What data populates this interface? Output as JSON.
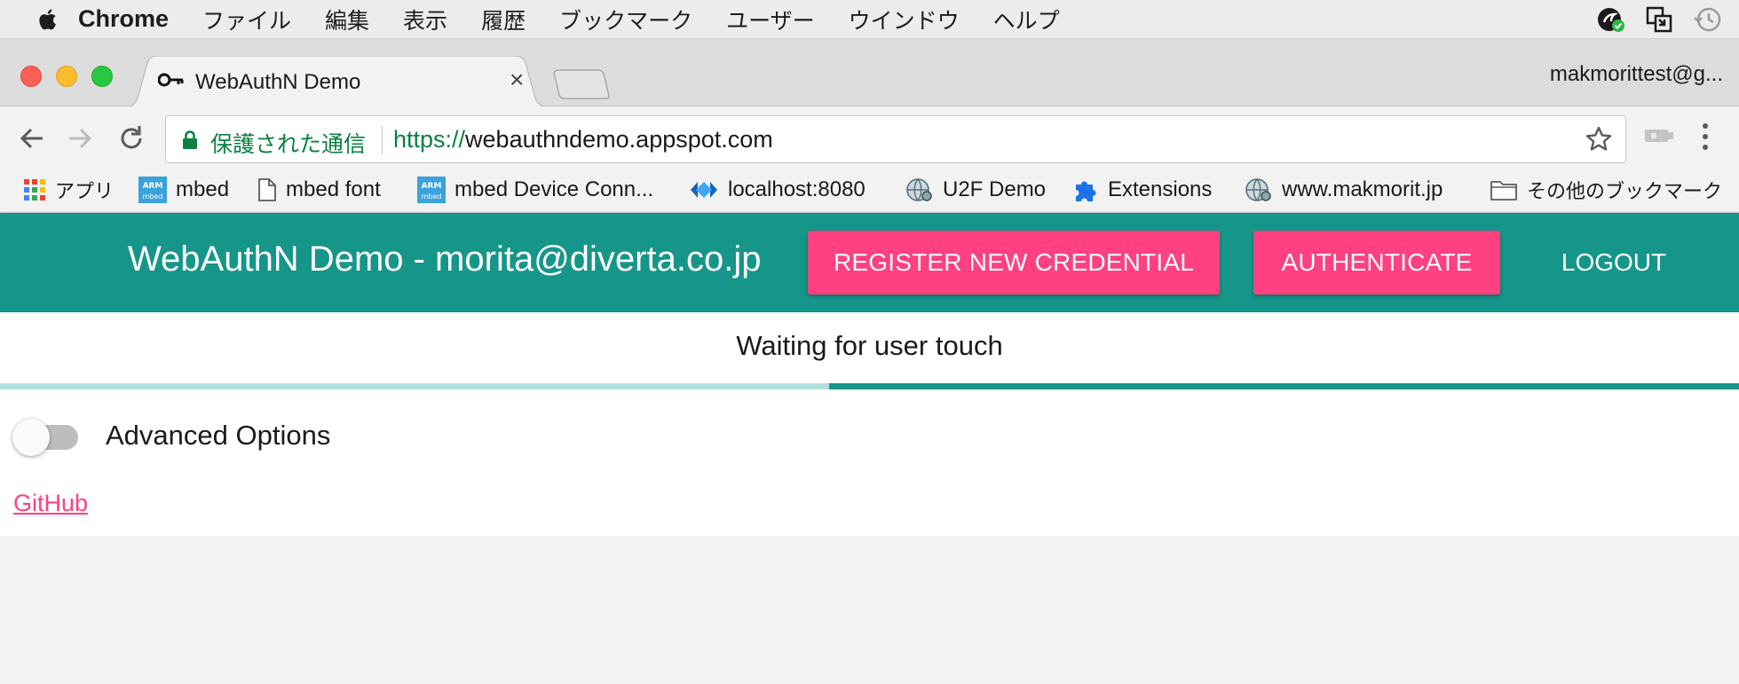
{
  "menubar": {
    "app_name": "Chrome",
    "items": [
      "ファイル",
      "編集",
      "表示",
      "履歴",
      "ブックマーク",
      "ユーザー",
      "ウインドウ",
      "ヘルプ"
    ]
  },
  "tab": {
    "title": "WebAuthN Demo",
    "close": "×"
  },
  "profile": "makmorittest@g...",
  "omnibox": {
    "security_label": "保護された通信",
    "url_scheme": "https://",
    "url_host": "webauthndemo.appspot.com"
  },
  "bookmarks": [
    {
      "label": "アプリ",
      "icon": "apps-grid-icon"
    },
    {
      "label": "mbed",
      "icon": "arm-mbed-icon"
    },
    {
      "label": "mbed font",
      "icon": "page-icon"
    },
    {
      "label": "mbed Device Conn...",
      "icon": "arm-mbed-icon"
    },
    {
      "label": "localhost:8080",
      "icon": "diamond-arrows-icon"
    },
    {
      "label": "U2F Demo",
      "icon": "globe-gear-icon"
    },
    {
      "label": "Extensions",
      "icon": "puzzle-icon"
    },
    {
      "label": "www.makmorit.jp",
      "icon": "globe-gear-icon"
    },
    {
      "label": "その他のブックマーク",
      "icon": "folder-icon"
    }
  ],
  "app": {
    "title": "WebAuthN Demo - morita@diverta.co.jp",
    "register_button": "REGISTER NEW CREDENTIAL",
    "authenticate_button": "AUTHENTICATE",
    "logout_button": "LOGOUT",
    "status": "Waiting for user touch",
    "advanced_options": "Advanced Options",
    "advanced_options_enabled": false,
    "github_link": "GitHub"
  },
  "colors": {
    "header_bg": "#169689",
    "accent_pink": "#ff4081",
    "progress_track": "#b2dfdb",
    "progress_fill": "#169689"
  }
}
